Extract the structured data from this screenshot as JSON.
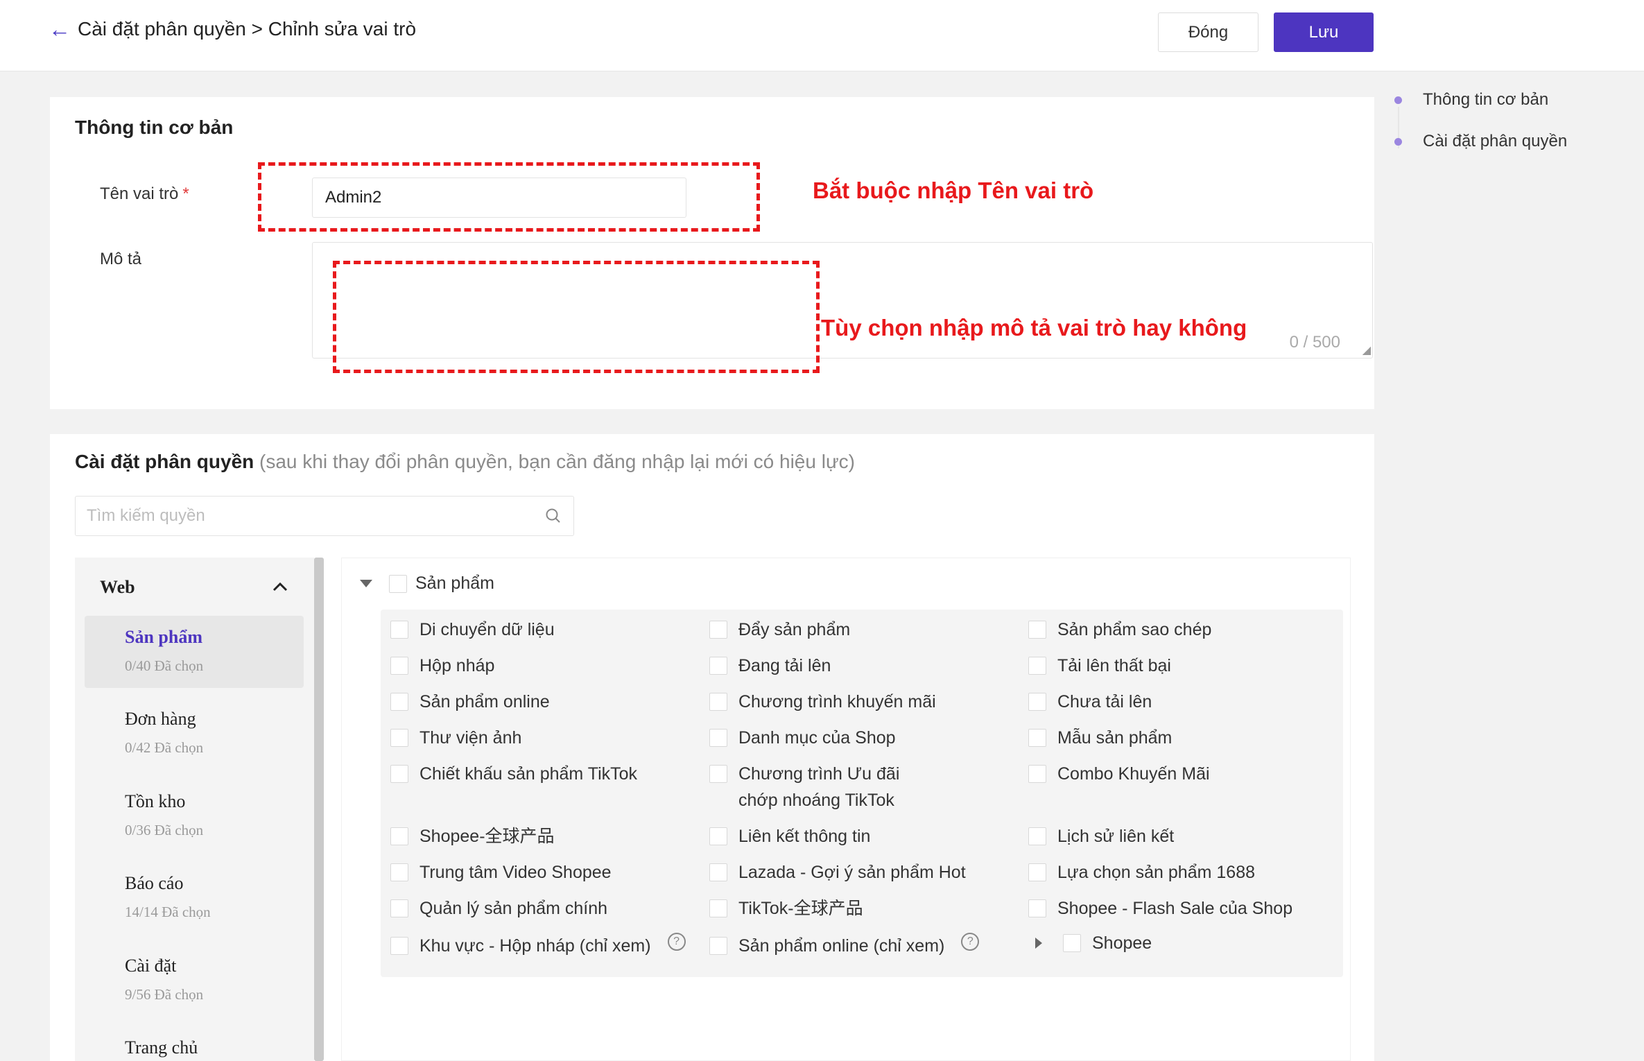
{
  "header": {
    "breadcrumb": "Cài đặt phân quyền > Chỉnh sửa vai trò",
    "close_label": "Đóng",
    "save_label": "Lưu"
  },
  "anchors": [
    "Thông tin cơ bản",
    "Cài đặt phân quyền"
  ],
  "basic_info": {
    "title": "Thông tin cơ bản",
    "name_label": "Tên vai trò",
    "required_mark": "*",
    "name_value": "Admin2",
    "desc_label": "Mô tả",
    "desc_counter": "0 / 500",
    "note_required": "Bắt buộc nhập Tên vai trò",
    "note_optional": "Tùy chọn nhập mô tả vai trò hay không"
  },
  "permissions": {
    "title": "Cài đặt phân quyền",
    "note": "(sau khi thay đổi phân quyền, bạn cần đăng nhập lại mới có hiệu lực)",
    "search_placeholder": "Tìm kiếm quyền",
    "nav_head": "Web",
    "nav_items": [
      {
        "name": "Sản phẩm",
        "count": "0/40 Đã chọn",
        "active": true
      },
      {
        "name": "Đơn hàng",
        "count": "0/42 Đã chọn"
      },
      {
        "name": "Tồn kho",
        "count": "0/36 Đã chọn"
      },
      {
        "name": "Báo cáo",
        "count": "14/14 Đã chọn"
      },
      {
        "name": "Cài đặt",
        "count": "9/56 Đã chọn"
      },
      {
        "name": "Trang chủ",
        "count": ""
      }
    ],
    "group": "Sản phẩm",
    "items": {
      "c1": [
        "Di chuyển dữ liệu",
        "Hộp nháp",
        "Sản phẩm online",
        "Thư viện ảnh",
        "Chiết khấu sản phẩm TikTok",
        "Shopee-全球产品",
        "Trung tâm Video Shopee",
        "Quản lý sản phẩm chính",
        "Khu vực - Hộp nháp (chỉ xem)"
      ],
      "c2": [
        "Đẩy sản phẩm",
        "Đang tải lên",
        "Chương trình khuyến mãi",
        "Danh mục của Shop",
        "Chương trình Ưu đãi chớp nhoáng TikTok",
        "Liên kết thông tin",
        "Lazada - Gợi ý sản phẩm Hot",
        "TikTok-全球产品",
        "Sản phẩm online (chỉ xem)"
      ],
      "c3": [
        "Sản phẩm sao chép",
        "Tải lên thất bại",
        "Chưa tải lên",
        "Mẫu sản phẩm",
        "Combo Khuyến Mãi",
        "Lịch sử liên kết",
        "Lựa chọn sản phẩm 1688",
        "Shopee - Flash Sale của Shop",
        "Shopee"
      ]
    },
    "help_glyph": "?"
  },
  "colors": {
    "accent": "#4d35c0",
    "annotation": "#e8191c"
  }
}
